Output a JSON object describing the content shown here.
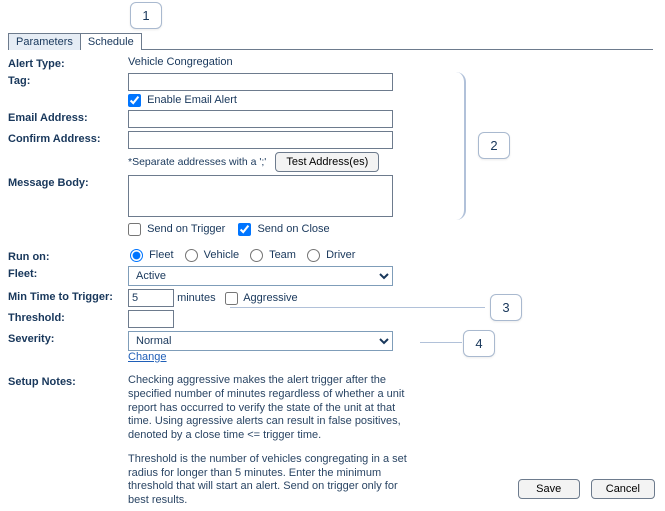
{
  "callouts": {
    "c1": "1",
    "c2": "2",
    "c3": "3",
    "c4": "4"
  },
  "tabs": {
    "parameters": "Parameters",
    "schedule": "Schedule"
  },
  "labels": {
    "alert_type": "Alert Type:",
    "tag": "Tag:",
    "email": "Email Address:",
    "confirm": "Confirm Address:",
    "msg_body": "Message Body:",
    "run_on": "Run on:",
    "fleet": "Fleet:",
    "min_time": "Min Time to Trigger:",
    "threshold": "Threshold:",
    "severity": "Severity:",
    "setup_notes": "Setup Notes:"
  },
  "values": {
    "alert_type_value": "Vehicle Congregation",
    "tag": "",
    "enable_email": "Enable Email Alert",
    "email": "",
    "confirm": "",
    "separator_hint": "*Separate addresses with a ';'",
    "test_addresses_btn": "Test Address(es)",
    "msg_body": "",
    "send_trigger": "Send on Trigger",
    "send_close": "Send on Close",
    "run_fleet": "Fleet",
    "run_vehicle": "Vehicle",
    "run_team": "Team",
    "run_driver": "Driver",
    "fleet_select": "Active",
    "min_time_val": "5",
    "minutes": "minutes",
    "aggressive": "Aggressive",
    "threshold_val": "",
    "severity_select": "Normal",
    "change_link": "Change",
    "notes_p1": "Checking aggressive makes the alert trigger after the specified number of minutes regardless of whether a unit report has occurred to verify the state of the unit at that time. Using agressive alerts can result in false positives, denoted by a close time <= trigger time.",
    "notes_p2": "Threshold is the number of vehicles congregating in a set radius for longer than 5 minutes. Enter the minimum threshold that will start an alert. Send on trigger only for best results."
  },
  "footer": {
    "save": "Save",
    "cancel": "Cancel"
  }
}
